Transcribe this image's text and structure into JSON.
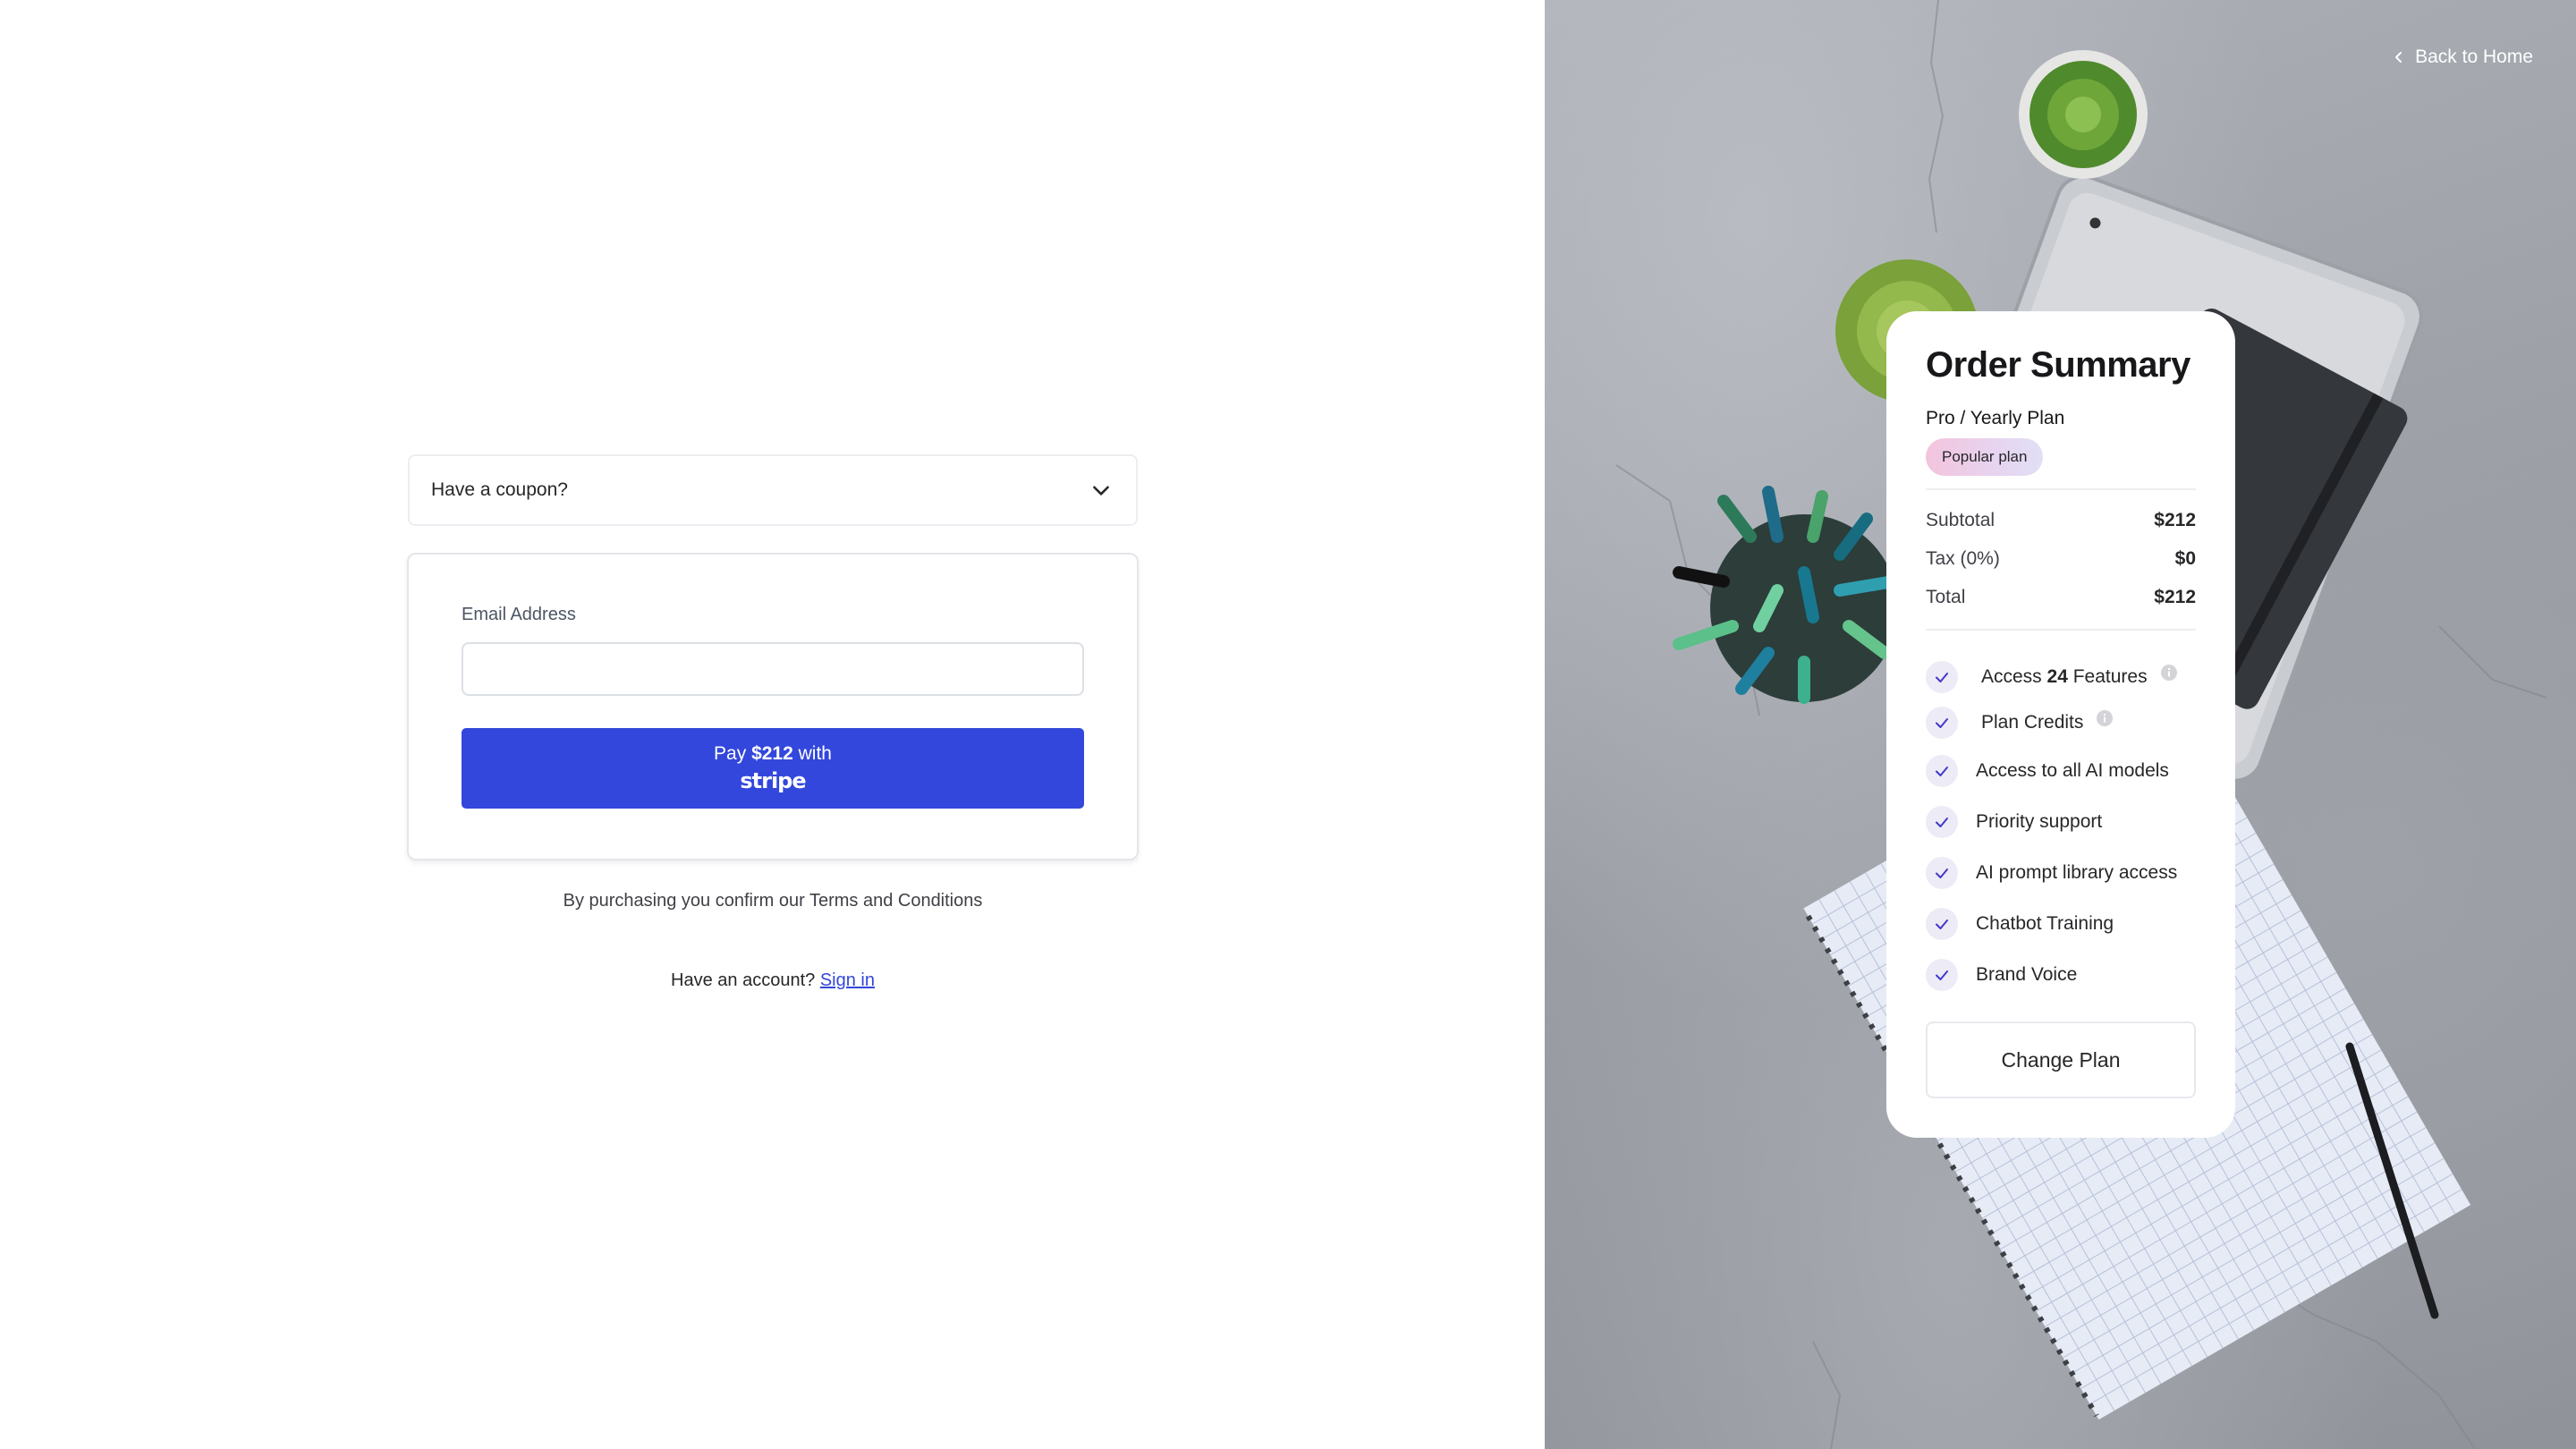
{
  "checkout": {
    "coupon_label": "Have a coupon?",
    "email": {
      "label": "Email Address",
      "value": "",
      "placeholder": ""
    },
    "pay_button": {
      "prefix": "Pay ",
      "amount": "$212",
      "suffix": " with",
      "brand": "stripe"
    },
    "terms_text": "By purchasing you confirm our Terms and Conditions",
    "account_prompt": "Have an account? ",
    "signin_label": "Sign in"
  },
  "header": {
    "back_label": "Back to Home"
  },
  "summary": {
    "title": "Order Summary",
    "plan_name": "Pro / Yearly Plan",
    "badge": "Popular plan",
    "rows": [
      {
        "label": "Subtotal",
        "value": "$212"
      },
      {
        "label": "Tax (0%)",
        "value": "$0"
      },
      {
        "label": "Total",
        "value": "$212"
      }
    ],
    "features": [
      {
        "pre": "Access ",
        "bold": "24",
        "post": " Features",
        "info": true
      },
      {
        "label": "Plan Credits",
        "info": true
      },
      {
        "label": "Access to all AI models"
      },
      {
        "label": "Priority support"
      },
      {
        "label": "AI prompt library access"
      },
      {
        "label": "Chatbot Training"
      },
      {
        "label": "Brand Voice"
      }
    ],
    "change_plan_label": "Change Plan"
  },
  "icons": {
    "coupon_toggle": "chevron-down-icon",
    "back": "chevron-left-icon",
    "feature_check": "check-icon",
    "feature_info": "info-icon"
  },
  "colors": {
    "accent": "#3347dc",
    "badge_gradient_start": "#f3c4dd",
    "badge_gradient_end": "#e1dff6",
    "check_bg": "#ecebf6",
    "check_stroke": "#4338ca"
  }
}
